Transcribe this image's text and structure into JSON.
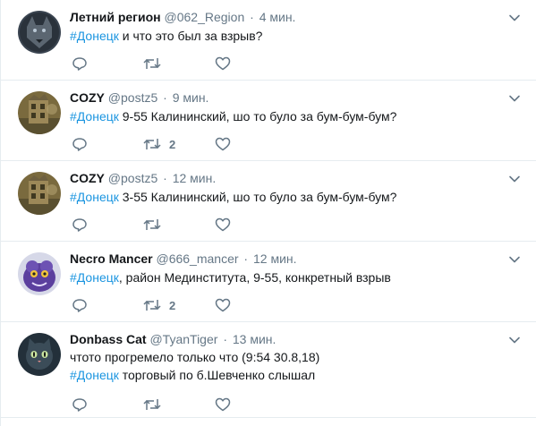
{
  "tweets": [
    {
      "name": "Летний регион",
      "handle": "@062_Region",
      "dot": "·",
      "time": "4 мин.",
      "line1_hashtag": "#Донецк",
      "line1_rest": " и что это был за взрыв?",
      "line2_hashtag": "",
      "line2_rest": "",
      "retweet_count": "",
      "avatar": "dark-wolf-avatar"
    },
    {
      "name": "COZY",
      "handle": "@postz5",
      "dot": "·",
      "time": "9 мин.",
      "line1_hashtag": "#Донецк",
      "line1_rest": " 9-55 Калининский, шо то було за бум-бум-бум?",
      "line2_hashtag": "",
      "line2_rest": "",
      "retweet_count": "2",
      "avatar": "ruined-building-avatar"
    },
    {
      "name": "COZY",
      "handle": "@postz5",
      "dot": "·",
      "time": "12 мин.",
      "line1_hashtag": "#Донецк",
      "line1_rest": " 3-55 Калининский, шо то було за бум-бум-бум?",
      "line2_hashtag": "",
      "line2_rest": "",
      "retweet_count": "",
      "avatar": "ruined-building-avatar"
    },
    {
      "name": "Necro Mancer",
      "handle": "@666_mancer",
      "dot": "·",
      "time": "12 мин.",
      "line1_hashtag": "#Донецк",
      "line1_rest": ", район Мединститута, 9-55, конкретный взрыв",
      "line2_hashtag": "",
      "line2_rest": "",
      "retweet_count": "2",
      "avatar": "purple-monster-avatar"
    },
    {
      "name": "Donbass Cat",
      "handle": "@TyanTiger",
      "dot": "·",
      "time": "13 мин.",
      "line1_hashtag": "",
      "line1_rest": "чтото прогремело только что (9:54 30.8,18)",
      "line2_hashtag": "#Донецк",
      "line2_rest": " торговый по б.Шевченко слышал",
      "retweet_count": "",
      "avatar": "cat-avatar"
    }
  ],
  "icons": {
    "reply": "reply-icon",
    "retweet": "retweet-icon",
    "like": "like-icon",
    "more": "chevron-down-icon"
  },
  "colors": {
    "hashtag": "#1b95e0",
    "secondary_text": "#657786",
    "primary_text": "#14171a",
    "divider": "#e6ecf0"
  }
}
